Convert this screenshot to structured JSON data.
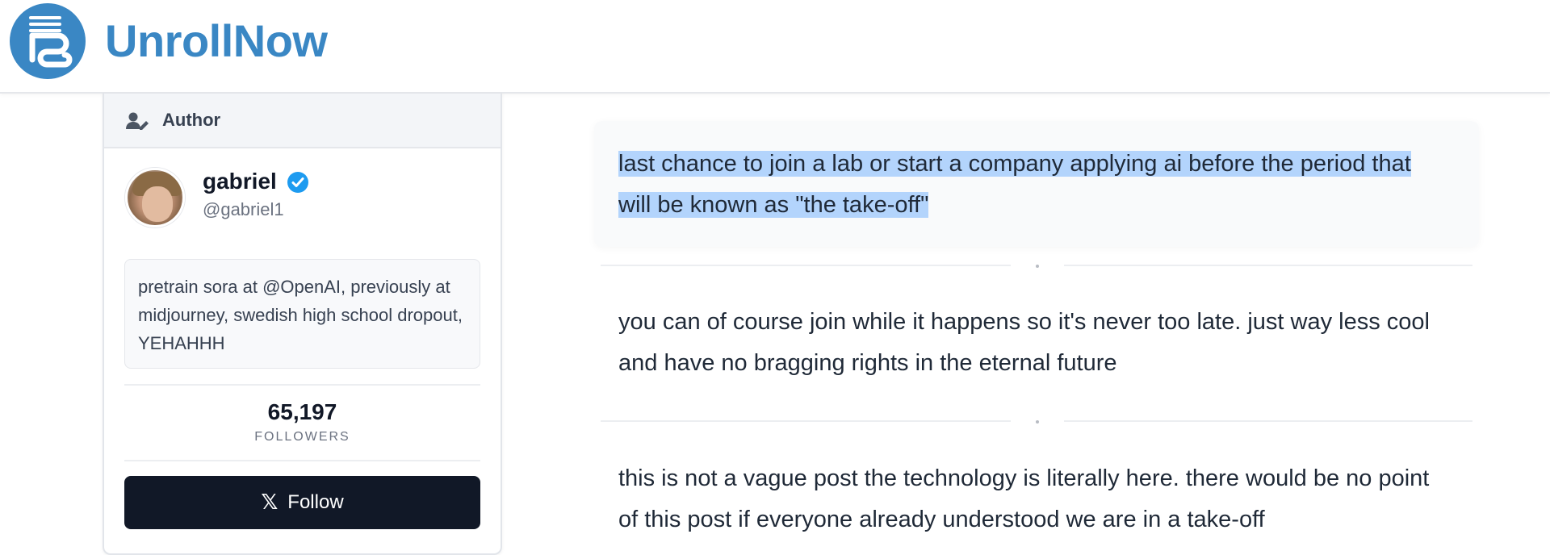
{
  "app": {
    "brand": "UnrollNow",
    "accent": "#3a87c4"
  },
  "author_card": {
    "header_label": "Author",
    "name": "gabriel",
    "handle": "@gabriel1",
    "bio": "pretrain sora at @OpenAI, previously at midjourney, swedish high school dropout, YEHAHHH",
    "followers_count": "65,197",
    "followers_label": "FOLLOWERS",
    "follow_button": "Follow",
    "icons": {
      "header": "user-edit-icon",
      "verified": "verified-badge-icon",
      "follow": "x-logo-icon"
    }
  },
  "thread": {
    "posts": [
      {
        "lines": [
          "last chance to join a lab or start a company applying ai before the period that",
          "will be known as \"the take-off\""
        ],
        "highlighted": true
      },
      {
        "lines": [
          "you can of course join while it happens so it's never too late. just way less cool",
          "and have no bragging rights in the eternal future"
        ],
        "highlighted": false
      },
      {
        "lines": [
          "this is not a vague post the technology is literally here. there would be no point",
          "of this post if everyone already understood we are in a take-off"
        ],
        "highlighted": false
      }
    ]
  }
}
